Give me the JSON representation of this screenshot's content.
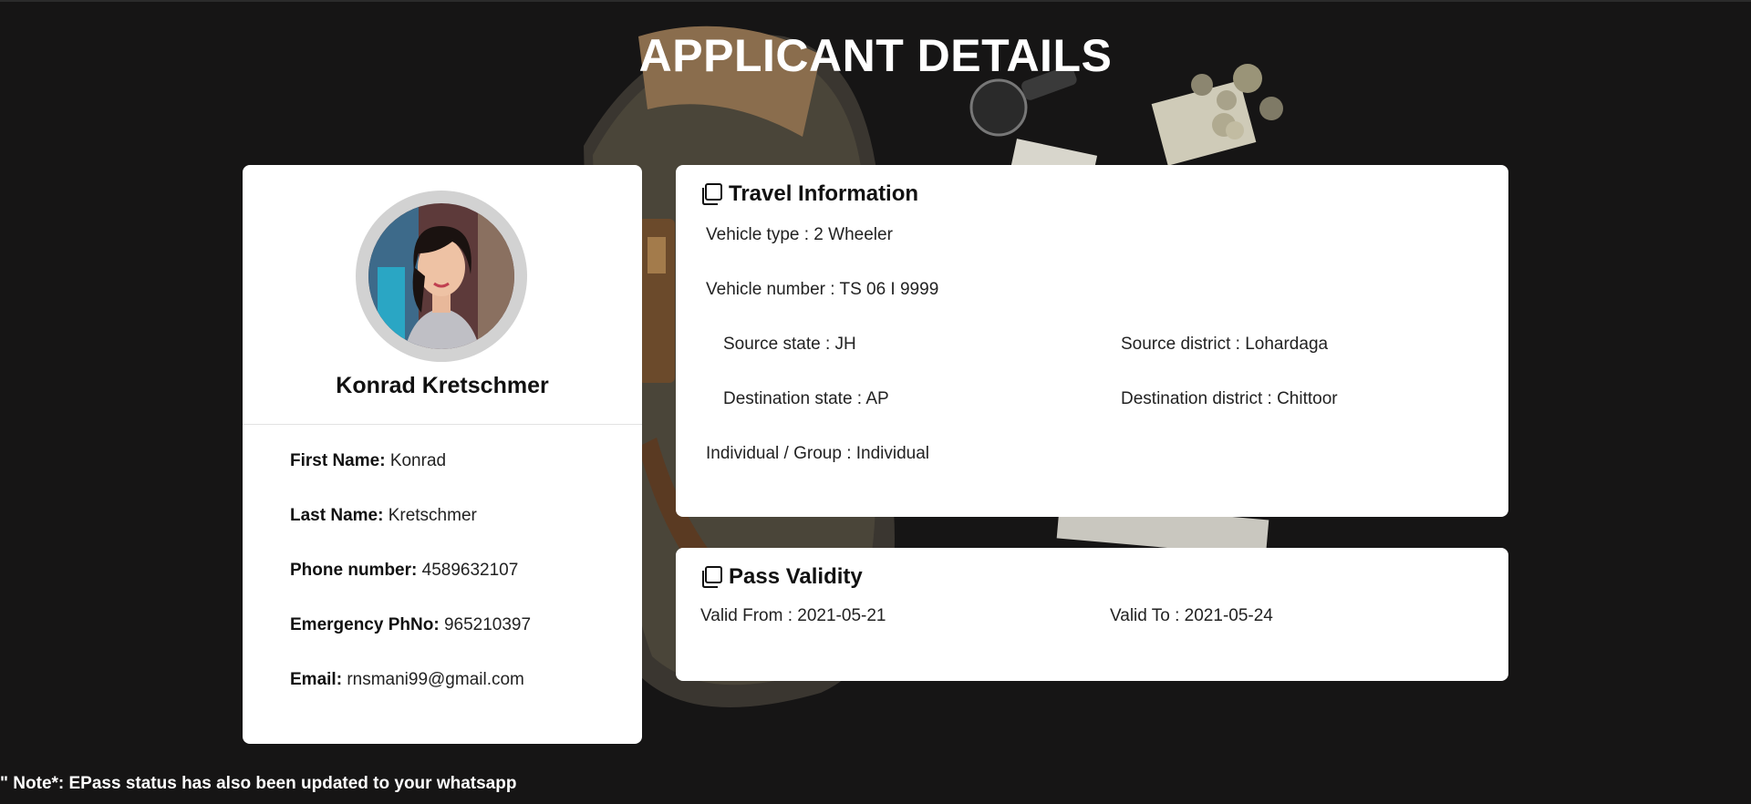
{
  "page": {
    "title": "APPLICANT DETAILS",
    "note": "\" Note*: EPass status has also been updated to your whatsapp"
  },
  "profile": {
    "full_name": "Konrad Kretschmer",
    "fields": [
      {
        "label": "First Name:",
        "value": "Konrad"
      },
      {
        "label": "Last Name:",
        "value": "Kretschmer"
      },
      {
        "label": "Phone number:",
        "value": "4589632107"
      },
      {
        "label": "Emergency PhNo:",
        "value": "965210397"
      },
      {
        "label": "Email:",
        "value": "rnsmani99@gmail.com"
      }
    ]
  },
  "travel": {
    "title": "Travel Information",
    "title_icon": "copy-icon",
    "vehicle_type": "Vehicle type : 2 Wheeler",
    "vehicle_number": "Vehicle number : TS 06 I 9999",
    "source_state": "Source state : JH",
    "source_district": "Source district : Lohardaga",
    "destination_state": "Destination state : AP",
    "destination_district": "Destination district : Chittoor",
    "individual_group": "Individual / Group : Individual"
  },
  "validity": {
    "title": "Pass Validity",
    "title_icon": "copy-icon",
    "valid_from": "Valid From : 2021-05-21",
    "valid_to": "Valid To : 2021-05-24"
  },
  "colors": {
    "background": "#161515",
    "card": "#ffffff",
    "avatar_ring": "#d2d2d2",
    "text": "#111111"
  }
}
